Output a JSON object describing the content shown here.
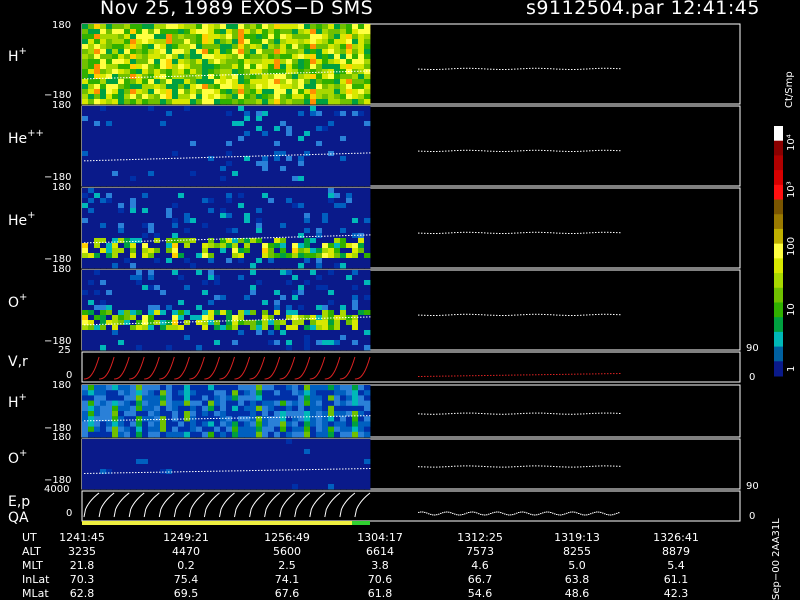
{
  "header": {
    "title": "Nov 25, 1989   EXOS−D SMS",
    "file": "s9112504.par  12:41:45"
  },
  "colors": {
    "background": "#000000",
    "panel_bg": "#0a1a8a",
    "trace": "#ffffff",
    "velocity_trace": "#dd2222",
    "qa_good": "#f0f040",
    "qa_other": "#30d030"
  },
  "panels": {
    "p1": {
      "label_base": "H",
      "label_sup": "+",
      "ytop": "180",
      "ybot": "−180"
    },
    "p2": {
      "label_base": "He",
      "label_sup": "++",
      "ytop": "180",
      "ybot": "−180"
    },
    "p3": {
      "label_base": "He",
      "label_sup": "+",
      "ytop": "180",
      "ybot": "−180"
    },
    "p4": {
      "label_base": "O",
      "label_sup": "+",
      "ytop": "180",
      "ybot": "−180"
    },
    "p5": {
      "label": "V,r",
      "ytop": "25",
      "ybot": "0",
      "rtop": "90",
      "rbot": "0"
    },
    "p6": {
      "label_base": "H",
      "label_sup": "+",
      "ytop": "180",
      "ybot": "−180"
    },
    "p7": {
      "label_base": "O",
      "label_sup": "+",
      "ytop": "180",
      "ybot": "−180"
    },
    "p8": {
      "label1": "E,p",
      "label2": "QA",
      "ytop": "4000",
      "ybot": "0",
      "rtop": "90",
      "rbot": "0"
    }
  },
  "colorbar": {
    "unit": "Ct/Smp",
    "ticks": [
      "10⁴",
      "10³",
      "100",
      "10",
      "1"
    ],
    "colors": [
      "#ffffff",
      "#8a0000",
      "#b00000",
      "#d80000",
      "#ff1010",
      "#7a5500",
      "#9a7a00",
      "#c0b000",
      "#ffff40",
      "#d8e800",
      "#a8d800",
      "#70c000",
      "#30b000",
      "#00a040",
      "#00b8b8",
      "#0060a0",
      "#0a1a8a"
    ]
  },
  "chart_data": {
    "type": "heatmap",
    "title": "Nov 25, 1989   EXOS−D SMS",
    "xlabel": "UT",
    "x_ticks": [
      "1241:45",
      "1249:21",
      "1256:49",
      "1304:17",
      "1312:25",
      "1319:13",
      "1326:41"
    ],
    "data_coverage_end": "1304:17+",
    "colorbar_unit": "Ct/Smp",
    "colorbar_log": true,
    "series": [
      {
        "name": "H+",
        "ylim": [
          -180,
          180
        ]
      },
      {
        "name": "He++",
        "ylim": [
          -180,
          180
        ]
      },
      {
        "name": "He+",
        "ylim": [
          -180,
          180
        ]
      },
      {
        "name": "O+",
        "ylim": [
          -180,
          180
        ]
      },
      {
        "name": "V,r",
        "ylim": [
          0,
          25
        ],
        "right_ylim": [
          0,
          90
        ]
      },
      {
        "name": "H+",
        "ylim": [
          -180,
          180
        ]
      },
      {
        "name": "O+",
        "ylim": [
          -180,
          180
        ]
      },
      {
        "name": "E,p / QA",
        "ylim": [
          0,
          4000
        ],
        "right_ylim": [
          0,
          90
        ]
      }
    ],
    "orbit_table": {
      "rows": [
        {
          "name": "UT",
          "values": [
            "1241:45",
            "1249:21",
            "1256:49",
            "1304:17",
            "1312:25",
            "1319:13",
            "1326:41"
          ]
        },
        {
          "name": "ALT",
          "values": [
            "3235",
            "4470",
            "5600",
            "6614",
            "7573",
            "8255",
            "8879"
          ]
        },
        {
          "name": "MLT",
          "values": [
            "21.8",
            "0.2",
            "2.5",
            "3.8",
            "4.6",
            "5.0",
            "5.4"
          ]
        },
        {
          "name": "InLat",
          "values": [
            "70.3",
            "75.4",
            "74.1",
            "70.6",
            "66.7",
            "63.8",
            "61.1"
          ]
        },
        {
          "name": "MLat",
          "values": [
            "62.8",
            "69.5",
            "67.6",
            "61.8",
            "54.6",
            "48.6",
            "42.3"
          ]
        }
      ]
    }
  },
  "footer": {
    "stamp": "Sep−00  2AA31L"
  }
}
